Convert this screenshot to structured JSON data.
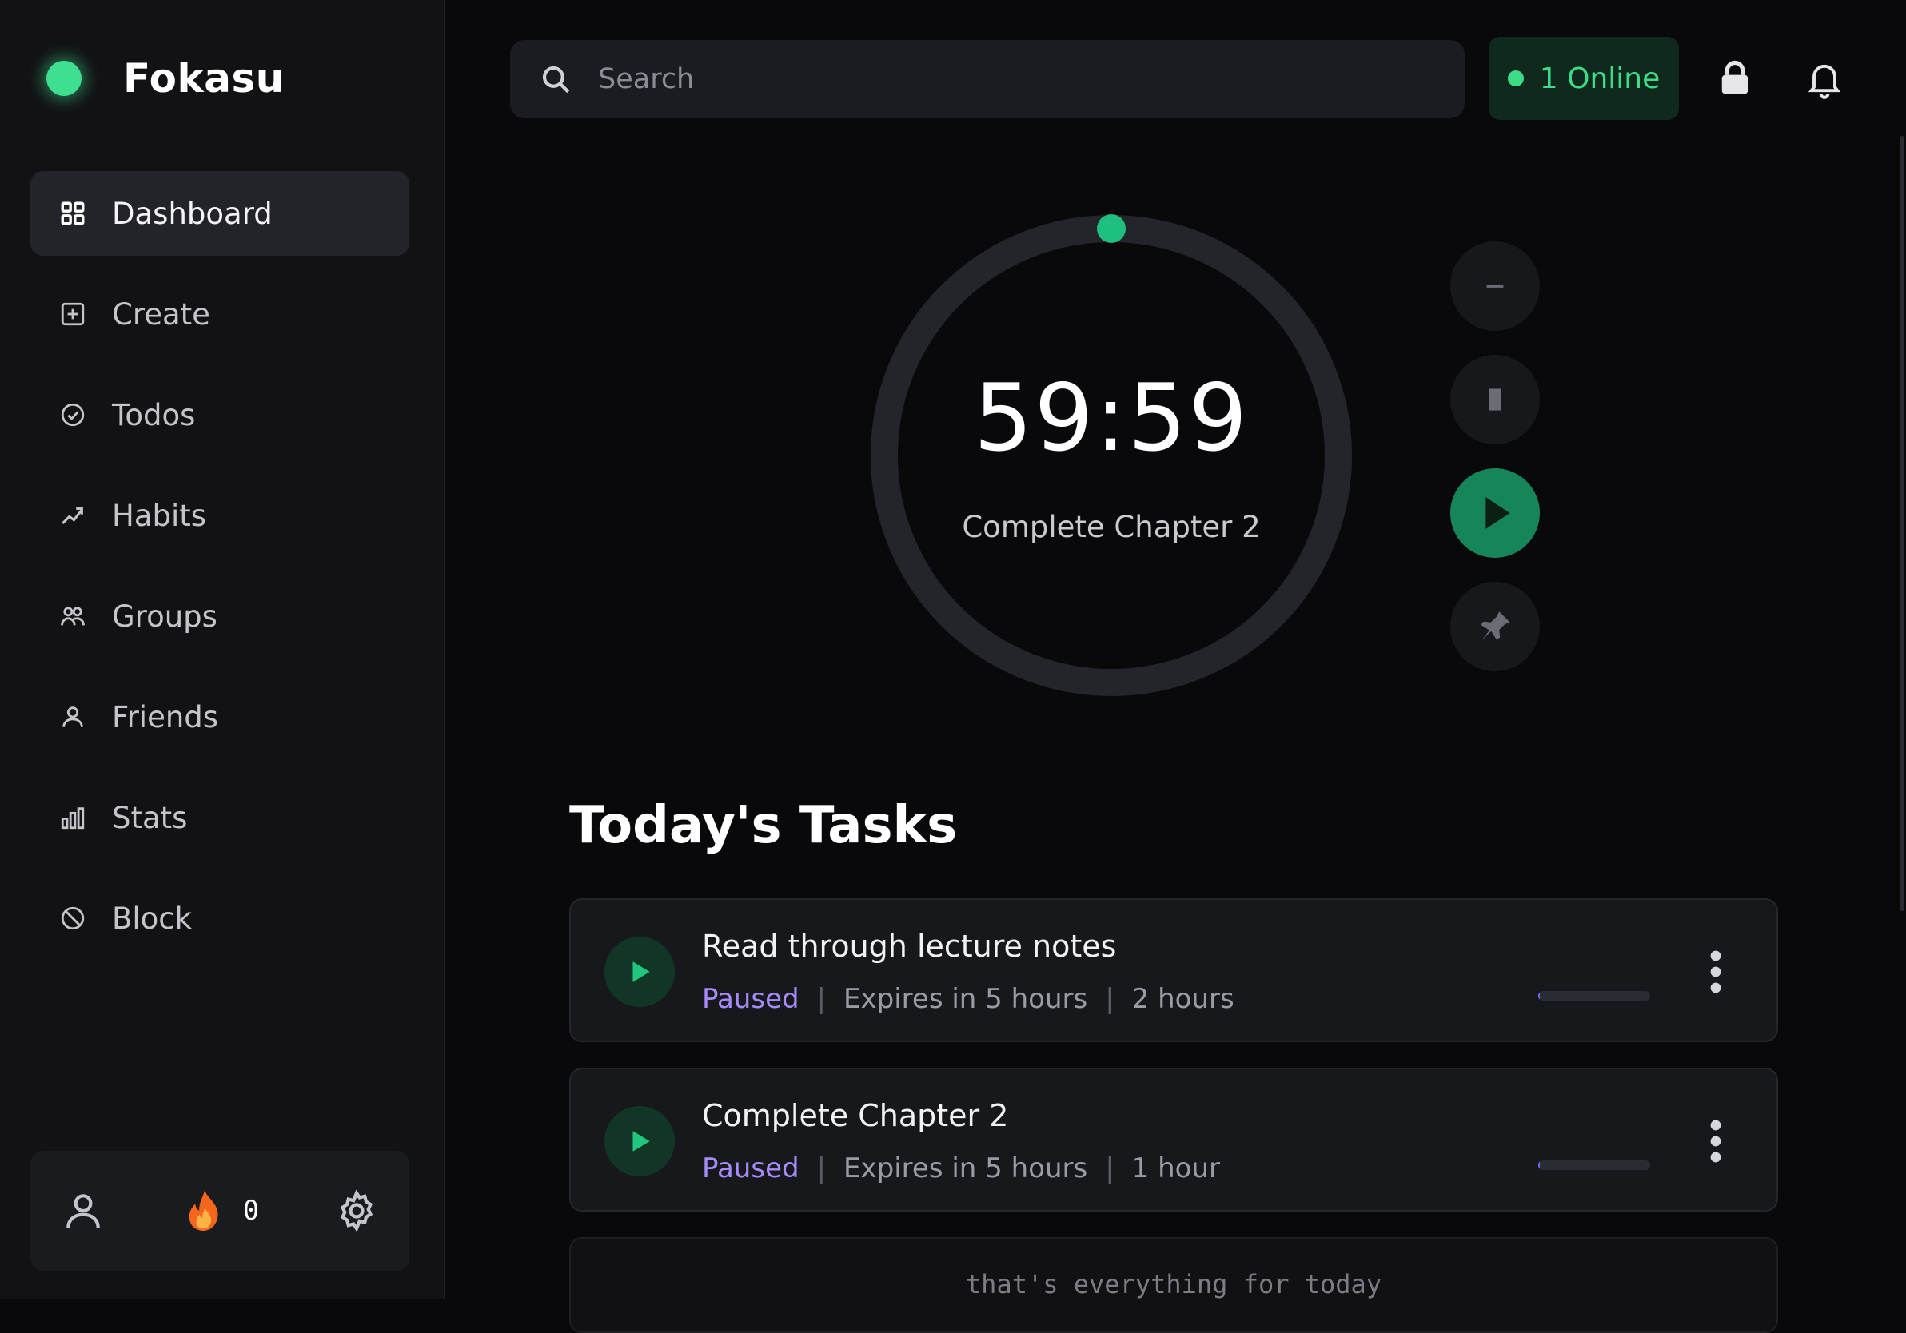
{
  "app": {
    "name": "Fokasu"
  },
  "sidebar": {
    "items": [
      {
        "label": "Dashboard",
        "icon": "grid-icon",
        "active": true
      },
      {
        "label": "Create",
        "icon": "plus-square-icon",
        "active": false
      },
      {
        "label": "Todos",
        "icon": "check-circle-icon",
        "active": false
      },
      {
        "label": "Habits",
        "icon": "trend-icon",
        "active": false
      },
      {
        "label": "Groups",
        "icon": "groups-icon",
        "active": false
      },
      {
        "label": "Friends",
        "icon": "user-icon",
        "active": false
      },
      {
        "label": "Stats",
        "icon": "bar-chart-icon",
        "active": false
      },
      {
        "label": "Block",
        "icon": "ban-icon",
        "active": false
      }
    ],
    "footer": {
      "streak_count": "0",
      "profile_icon": "user-icon",
      "streak_icon": "fire-icon",
      "settings_icon": "gear-icon"
    }
  },
  "header": {
    "search_placeholder": "Search",
    "online_label": "1 Online",
    "lock_icon": "lock-icon",
    "bell_icon": "bell-icon"
  },
  "timer": {
    "time": "59:59",
    "task": "Complete Chapter 2",
    "progress": 0
  },
  "tasks": {
    "title": "Today's Tasks",
    "items": [
      {
        "name": "Read through lecture notes",
        "status": "Paused",
        "expires": "Expires in 5 hours",
        "duration": "2 hours",
        "progress": 0.01
      },
      {
        "name": "Complete Chapter 2",
        "status": "Paused",
        "expires": "Expires in 5 hours",
        "duration": "1 hour",
        "progress": 0.01
      }
    ],
    "end_message": "that's everything for today"
  },
  "colors": {
    "accent": "#1fbf7f",
    "online_green": "#3ddc88",
    "status_purple": "#a78bfa",
    "background": "#09090b",
    "sidebar": "#121215"
  }
}
